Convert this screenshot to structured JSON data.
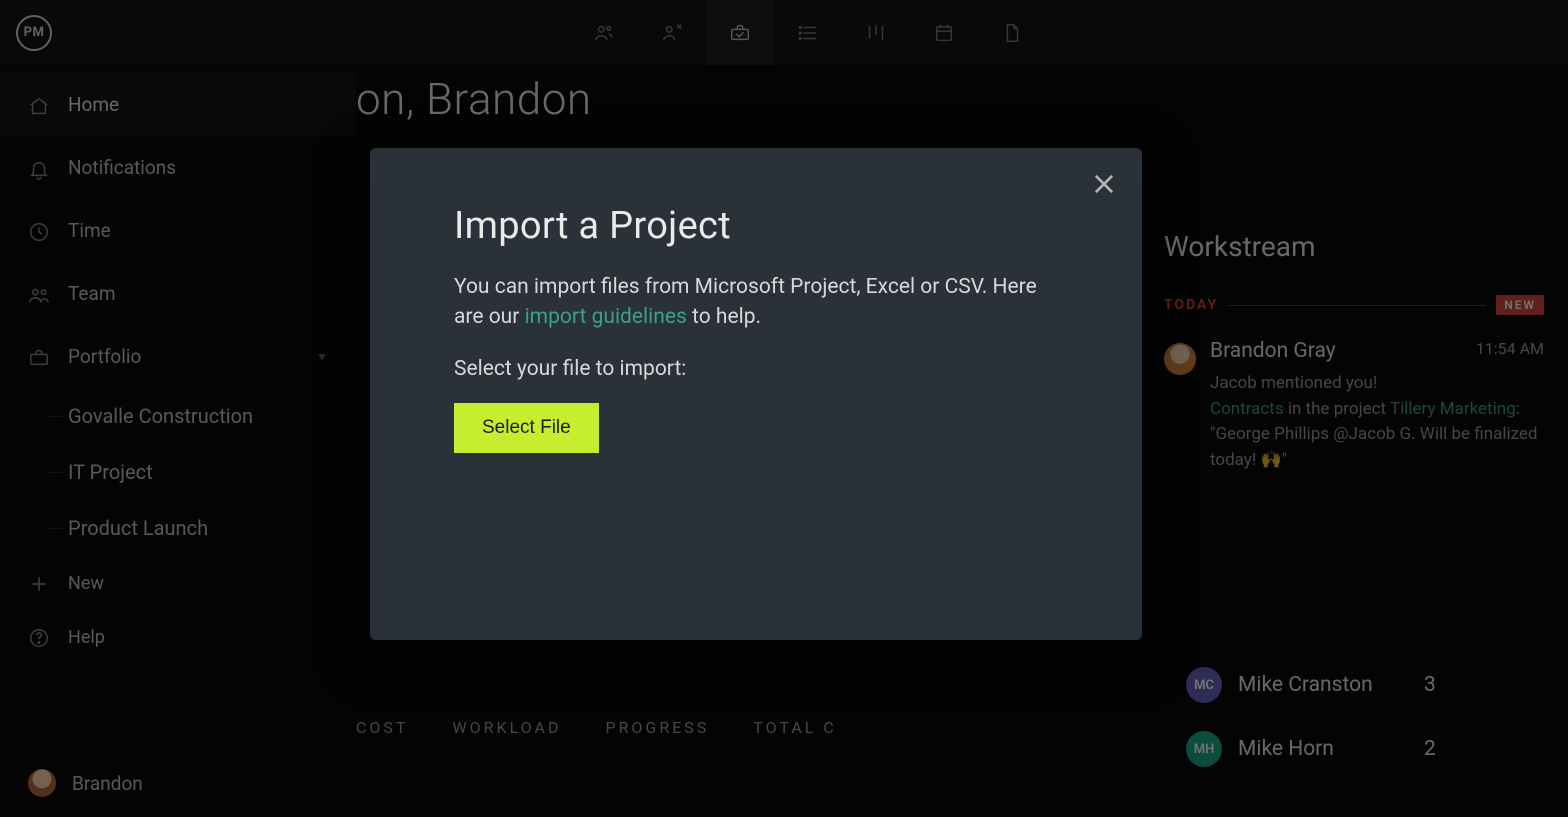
{
  "brand": {
    "logo": "PM"
  },
  "topnav": [
    {
      "name": "people-icon"
    },
    {
      "name": "people-add-icon"
    },
    {
      "name": "briefcase-icon",
      "active": true
    },
    {
      "name": "list-icon"
    },
    {
      "name": "board-icon"
    },
    {
      "name": "calendar-icon"
    },
    {
      "name": "document-icon"
    }
  ],
  "sidebar": {
    "items": [
      {
        "icon": "home-icon",
        "label": "Home",
        "active": true
      },
      {
        "icon": "bell-icon",
        "label": "Notifications"
      },
      {
        "icon": "clock-icon",
        "label": "Time"
      },
      {
        "icon": "team-icon",
        "label": "Team"
      },
      {
        "icon": "briefcase-icon",
        "label": "Portfolio",
        "expandable": true
      }
    ],
    "projects": [
      {
        "label": "Govalle Construction"
      },
      {
        "label": "IT Project"
      },
      {
        "label": "Product Launch"
      }
    ],
    "new": {
      "icon": "plus-icon",
      "label": "New"
    },
    "help": {
      "icon": "help-icon",
      "label": "Help"
    },
    "user": {
      "name": "Brandon"
    }
  },
  "main": {
    "greeting_visible_fragment": "on, Brandon",
    "metrics": [
      "COST",
      "WORKLOAD",
      "PROGRESS",
      "TOTAL C"
    ],
    "people": [
      {
        "initials": "MC",
        "name": "Mike Cranston",
        "count": "3",
        "color": "purple"
      },
      {
        "initials": "MH",
        "name": "Mike Horn",
        "count": "2",
        "color": "teal"
      }
    ]
  },
  "workstream": {
    "title": "Workstream",
    "today_label": "TODAY",
    "new_badge": "NEW",
    "message": {
      "author": "Brandon Gray",
      "time": "11:54 AM",
      "line1": "Jacob mentioned you!",
      "link1": "Contracts",
      "mid1": " in the project ",
      "link2": "Tillery Marketing",
      "tail": ": \"George Phillips @Jacob G. Will be finalized today! 🙌\""
    }
  },
  "modal": {
    "title": "Import a Project",
    "desc_pre": "You can import files from Microsoft Project, Excel or CSV. Here are our ",
    "desc_link": "import guidelines",
    "desc_post": " to help.",
    "select_label": "Select your file to import:",
    "button": "Select File"
  }
}
